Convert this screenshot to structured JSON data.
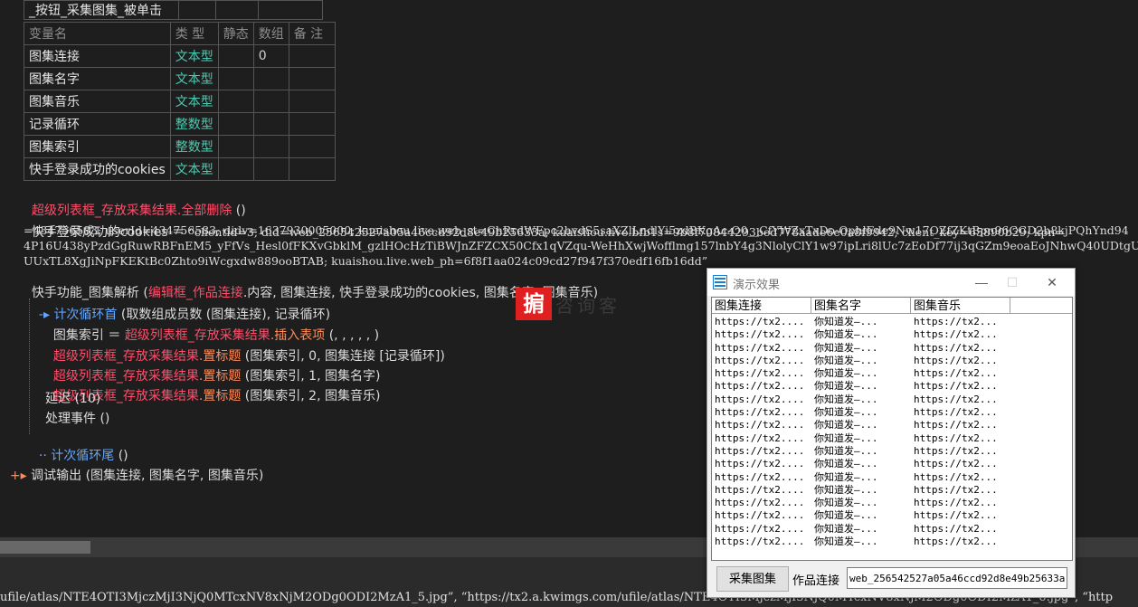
{
  "header_row": {
    "label": "_按钮_采集图集_被单击"
  },
  "var_table": {
    "headers": [
      "变量名",
      "类 型",
      "静态",
      "数组",
      "备 注"
    ],
    "rows": [
      {
        "name": "图集连接",
        "type": "文本型",
        "static": "",
        "array": "0",
        "note": ""
      },
      {
        "name": "图集名字",
        "type": "文本型",
        "static": "",
        "array": "",
        "note": ""
      },
      {
        "name": "图集音乐",
        "type": "文本型",
        "static": "",
        "array": "",
        "note": ""
      },
      {
        "name": "记录循环",
        "type": "整数型",
        "static": "",
        "array": "",
        "note": ""
      },
      {
        "name": "图集索引",
        "type": "整数型",
        "static": "",
        "array": "",
        "note": ""
      },
      {
        "name": "快手登录成功的cookies",
        "type": "文本型",
        "static": "",
        "array": "",
        "note": ""
      }
    ]
  },
  "code": {
    "line1_obj": "超级列表框_存放采集结果",
    "line1_method": ".全部删除",
    "line1_args": " ()",
    "line2_prefix": "快手登录成功的cookies ＝ ",
    "line2_value": "“clientid=3; did=web_256542527a05a46ccd92d8e49b25633a; kuaishou.live.bfb1s=9b8f70844293bed778aade6e0a8f9942; client_key=65890b29; kpn=",
    "line3": "=434756583; userId=434756583; didv=1637930005000; kuaishou.live.web_st=ChRrdWFpc2hvdS5saXZlLndlYi5zdBKgAc-O0__CfYWZxTxDo-OphlEde9Nw17OZfZKtBpn96GGD2h8kjPQhYnd94",
    "line4": "4P16U438yPzdGgRuwRBFnEM5_yFfVs_Hesl0fFKXvGbklM_gzlHOcHzTiBWJnZFZCX50Cfx1qVZqu-WeHhXwjWofflmg157lnbY4g3NlolyClY1w97ipLri8lUc7zEoDf77ij3qGZm9eoaEoJNhwQ40UDtgURWN6",
    "line5": "UUxTL8XgJiNpFKEKtBc0Zhto9iWcgxdw889ooBTAB; kuaishou.live.web_ph=6f8f1aa024c09cd27f947f370edf16fb16dd”",
    "line6_a": "快手功能_图集解析 (",
    "line6_b": "编辑框_作品连接",
    "line6_c": ".内容, 图集连接, 快手登录成功的cookies, 图集名字, 图集音乐)",
    "loop_start": "计次循环首",
    "loop_start_args": " (取数组成员数 (图集连接), 记录循环)",
    "line8_a": "图集索引 ＝ ",
    "line8_b": "超级列表框_存放采集结果",
    "line8_c": ".插入表项",
    "line8_d": " (, , , , , )",
    "line9_a": "超级列表框_存放采集结果",
    "line9_b": ".置标题",
    "line9_c": " (图集索引, 0, 图集连接 [记录循环])",
    "line10_c": " (图集索引, 1, 图集名字)",
    "line11_c": " (图集索引, 2, 图集音乐)",
    "line12": "延迟 (10)",
    "line13": "处理事件 ()",
    "loop_end": "计次循环尾",
    "loop_end_args": " ()",
    "line15_a": "调试输出",
    "line15_b": " (图集连接, 图集名字, 图集音乐)"
  },
  "bottom_text": "ufile/atlas/NTE4OTI3MjczMjI3NjQ0MTcxNV8xNjM2ODg0ODI2MzA1_5.jpg”, “https://tx2.a.kwimgs.com/ufile/atlas/NTE4OTI3MjczMjI3NjQ0MTcxNV8xNjM2ODg0ODI2MzA1_6.jpg”, “http",
  "logo": {
    "glyph": "掮",
    "ghost": "咨询客"
  },
  "demo_window": {
    "title": "演示效果",
    "minimize": "—",
    "maximize": "☐",
    "close": "✕",
    "columns": [
      "图集连接",
      "图集名字",
      "图集音乐"
    ],
    "rows": [
      [
        "https://tx2....",
        "你知道发—...",
        "https://tx2..."
      ],
      [
        "https://tx2....",
        "你知道发—...",
        "https://tx2..."
      ],
      [
        "https://tx2....",
        "你知道发—...",
        "https://tx2..."
      ],
      [
        "https://tx2....",
        "你知道发—...",
        "https://tx2..."
      ],
      [
        "https://tx2....",
        "你知道发—...",
        "https://tx2..."
      ],
      [
        "https://tx2....",
        "你知道发—...",
        "https://tx2..."
      ],
      [
        "https://tx2....",
        "你知道发—...",
        "https://tx2..."
      ],
      [
        "https://tx2....",
        "你知道发—...",
        "https://tx2..."
      ],
      [
        "https://tx2....",
        "你知道发—...",
        "https://tx2..."
      ],
      [
        "https://tx2....",
        "你知道发—...",
        "https://tx2..."
      ],
      [
        "https://tx2....",
        "你知道发—...",
        "https://tx2..."
      ],
      [
        "https://tx2....",
        "你知道发—...",
        "https://tx2..."
      ],
      [
        "https://tx2....",
        "你知道发—...",
        "https://tx2..."
      ],
      [
        "https://tx2....",
        "你知道发—...",
        "https://tx2..."
      ],
      [
        "https://tx2....",
        "你知道发—...",
        "https://tx2..."
      ],
      [
        "https://tx2....",
        "你知道发—...",
        "https://tx2..."
      ],
      [
        "https://tx2....",
        "你知道发—...",
        "https://tx2..."
      ],
      [
        "https://tx2....",
        "你知道发—...",
        "https://tx2..."
      ]
    ],
    "collect_button": "采集图集",
    "link_label": "作品连接",
    "link_value": "web_256542527a05a46ccd92d8e49b25633a"
  }
}
